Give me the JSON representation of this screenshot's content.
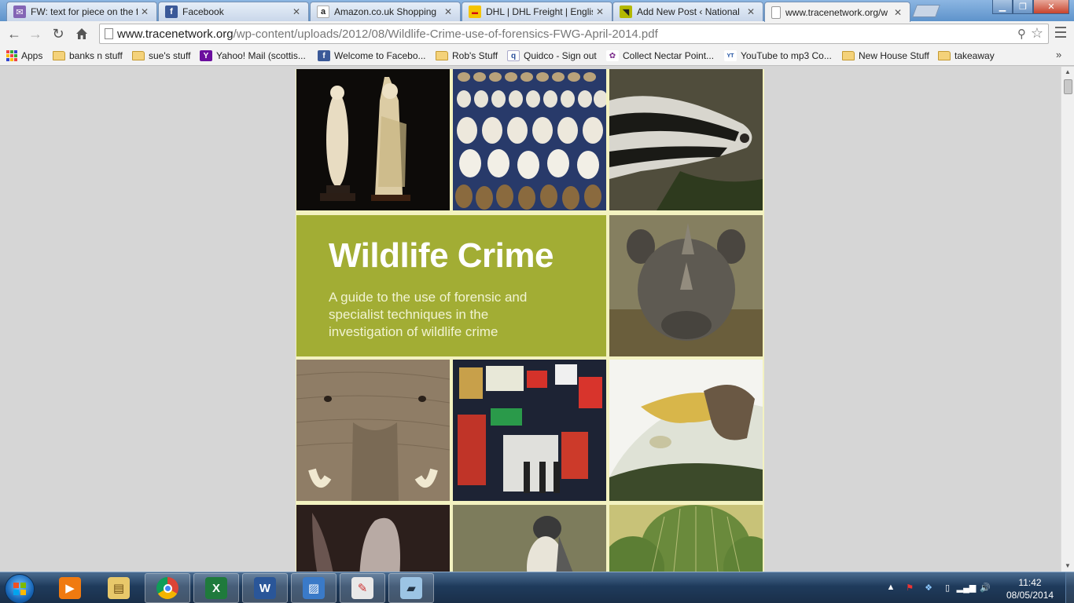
{
  "browser": {
    "tabs": [
      {
        "title": "FW: text for piece on the f",
        "favicon": "mail-icon",
        "color": "#7a5ba8"
      },
      {
        "title": "Facebook",
        "favicon": "facebook-icon",
        "color": "#3b5998"
      },
      {
        "title": "Amazon.co.uk Shopping",
        "favicon": "amazon-icon",
        "color": "#222222"
      },
      {
        "title": "DHL | DHL Freight | Englis",
        "favicon": "dhl-icon",
        "color": "#f5c400"
      },
      {
        "title": "Add New Post ‹ National",
        "favicon": "nwcu-icon",
        "color": "#b3b800"
      },
      {
        "title": "www.tracenetwork.org/w",
        "favicon": "page-icon",
        "color": "#ffffff"
      }
    ],
    "url_host": "www.tracenetwork.org",
    "url_path": "/wp-content/uploads/2012/08/Wildlife-Crime-use-of-forensics-FWG-April-2014.pdf",
    "bookmarks": [
      {
        "label": "Apps",
        "icon": "apps-grid-icon"
      },
      {
        "label": "banks n stuff",
        "icon": "folder-icon"
      },
      {
        "label": "sue's stuff",
        "icon": "folder-icon"
      },
      {
        "label": "Yahoo! Mail (scottis...",
        "icon": "yahoo-icon"
      },
      {
        "label": "Welcome to Facebo...",
        "icon": "facebook-icon"
      },
      {
        "label": "Rob's Stuff",
        "icon": "folder-icon"
      },
      {
        "label": "Quidco - Sign out",
        "icon": "quidco-icon"
      },
      {
        "label": "Collect Nectar Point...",
        "icon": "nectar-icon"
      },
      {
        "label": "YouTube to mp3 Co...",
        "icon": "yt-mp3-icon"
      },
      {
        "label": "New House Stuff",
        "icon": "folder-icon"
      },
      {
        "label": "takeaway",
        "icon": "folder-icon"
      }
    ],
    "bookmarks_overflow": "»"
  },
  "document": {
    "title": "Wildlife Crime",
    "subtitle": "A guide to the use of forensic and specialist techniques in the investigation of wildlife crime",
    "images": [
      "ivory-figurines",
      "bird-eggs",
      "badger",
      "rhino",
      "elephant",
      "traditional-medicines",
      "eagle-with-bird",
      "bat",
      "peregrine-falcon",
      "cacti"
    ],
    "accent": "#a2ad34"
  },
  "taskbar": {
    "apps": [
      "media-player-icon",
      "explorer-icon",
      "chrome-icon",
      "excel-icon",
      "word-icon",
      "photo-viewer-icon",
      "paint-icon",
      "notes-icon"
    ],
    "time": "11:42",
    "date": "08/05/2014"
  }
}
